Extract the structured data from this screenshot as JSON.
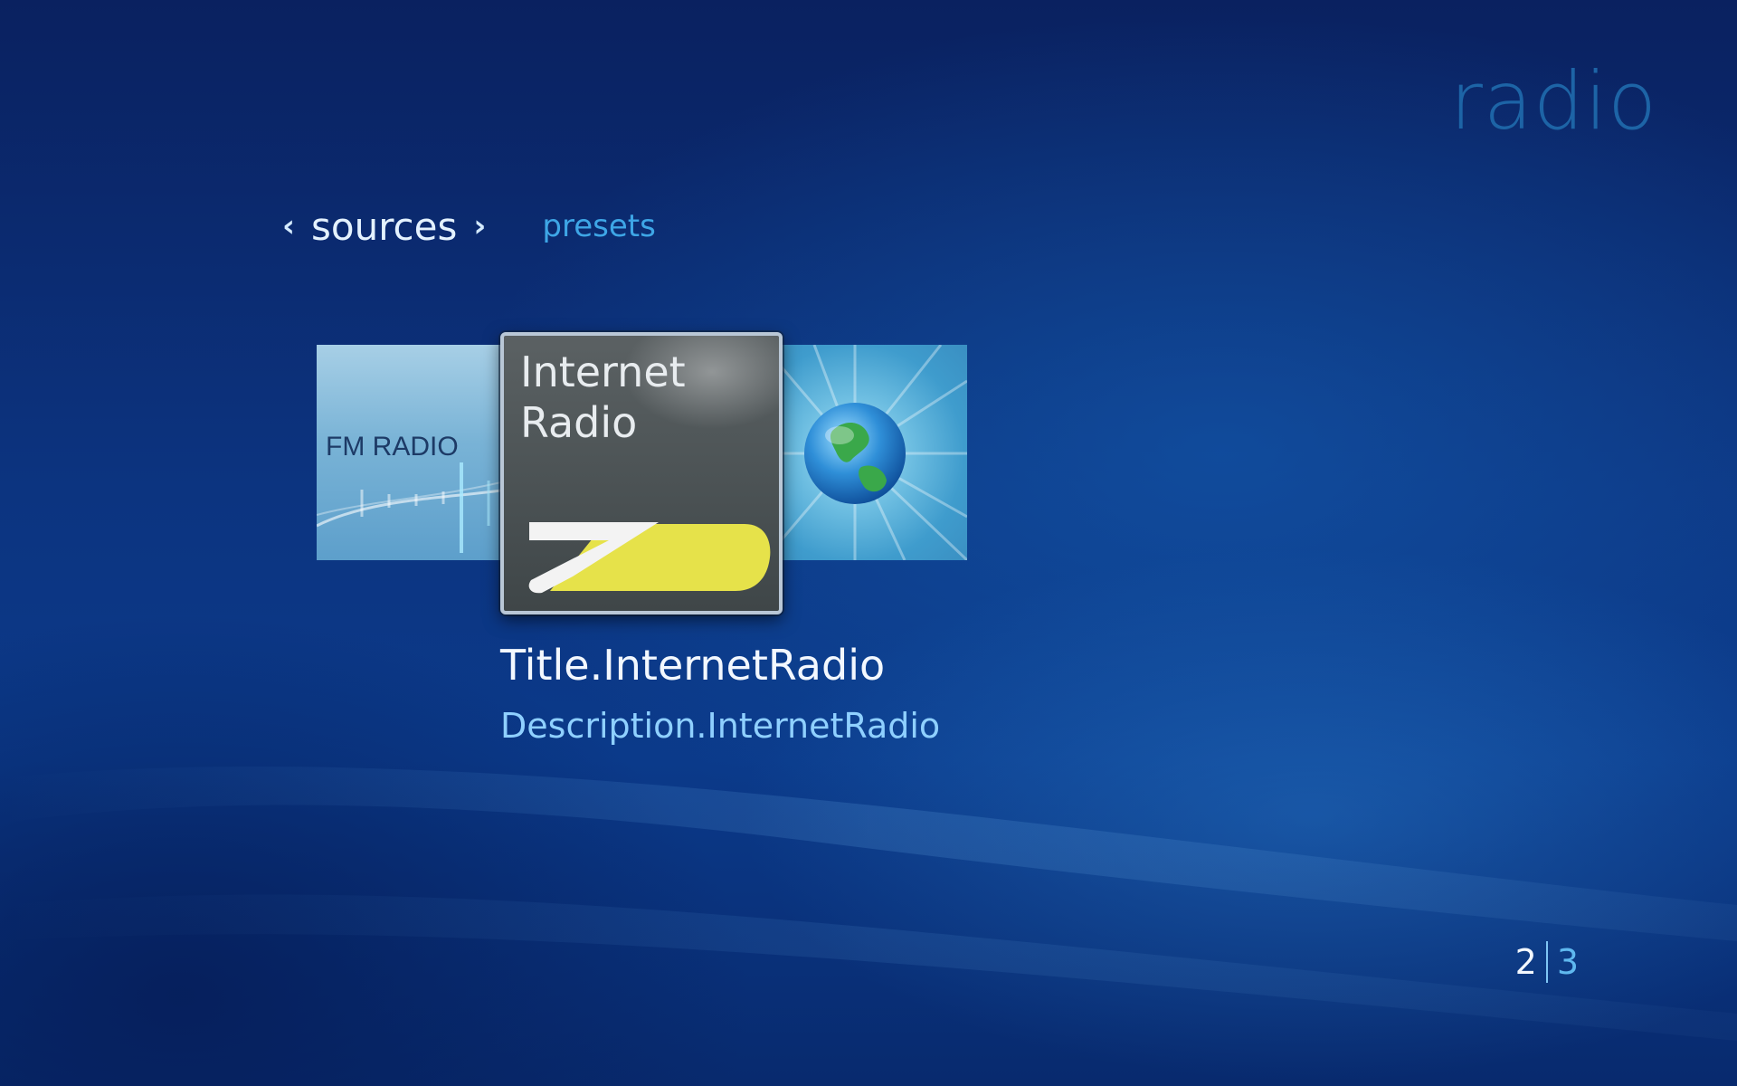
{
  "page": {
    "title": "radio"
  },
  "nav": {
    "current": "sources",
    "other": "presets"
  },
  "tiles": {
    "fm": {
      "label": "FM RADIO"
    },
    "internet": {
      "label": "Internet\nRadio"
    },
    "globe": {
      "icon": "globe-icon"
    }
  },
  "selected_item": {
    "title": "Title.InternetRadio",
    "description": "Description.InternetRadio"
  },
  "pager": {
    "current": "2",
    "total": "3"
  },
  "colors": {
    "accent": "#3ea6e6",
    "title": "#1d64a6",
    "logo_yellow": "#e6e24a"
  }
}
